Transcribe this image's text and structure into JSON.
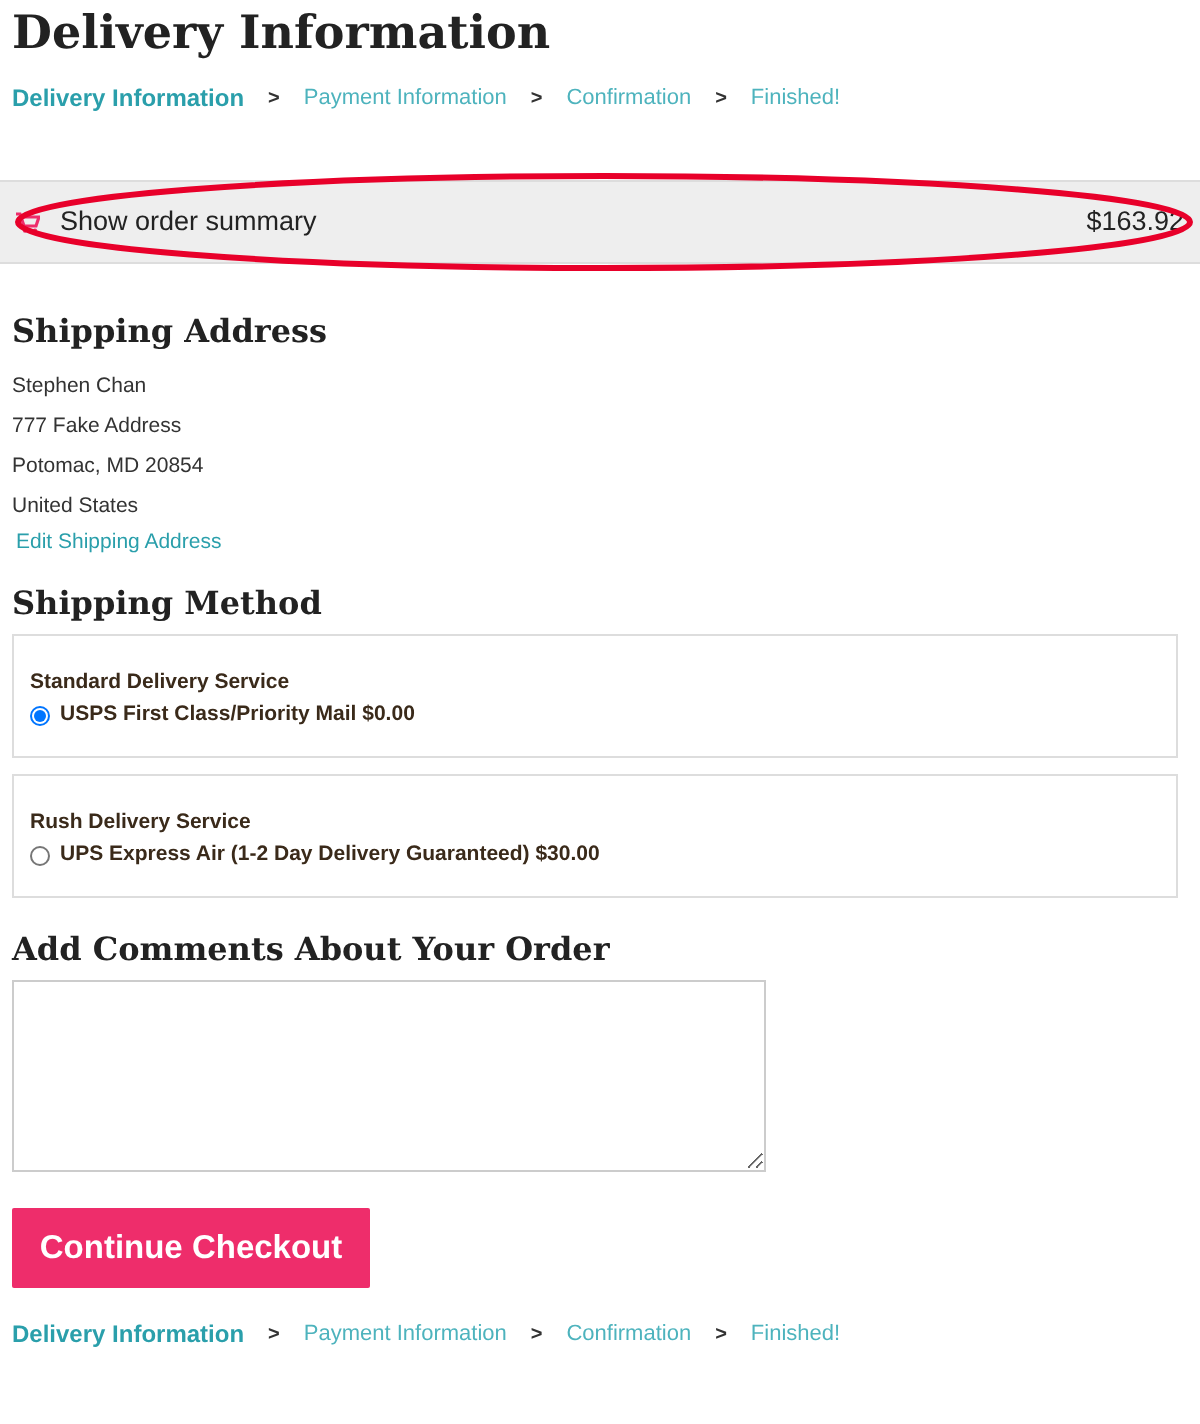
{
  "title": "Delivery Information",
  "breadcrumbs_top": {
    "separator": ">",
    "steps": [
      {
        "label": "Delivery Information",
        "selected": true
      },
      {
        "label": "Payment Information",
        "selected": false
      },
      {
        "label": "Confirmation",
        "selected": false
      },
      {
        "label": "Finished!",
        "selected": false
      }
    ]
  },
  "order_summary": {
    "label": "Show order summary",
    "total": "$163.92",
    "circled": true
  },
  "shipping_address": {
    "heading": "Shipping Address",
    "lines": [
      "Stephen Chan",
      "777 Fake Address",
      "Potomac, MD 20854",
      "United States"
    ],
    "edit_link": "Edit Shipping Address"
  },
  "shipping_method": {
    "heading": "Shipping Method",
    "options": [
      {
        "group": "Standard Delivery Service",
        "label": "USPS First Class/Priority Mail $0.00",
        "selected": true
      },
      {
        "group": "Rush Delivery Service",
        "label": "UPS Express Air (1-2 Day Delivery Guaranteed) $30.00",
        "selected": false
      }
    ]
  },
  "comments": {
    "heading": "Add Comments About Your Order"
  },
  "continue_button": "Continue Checkout",
  "breadcrumbs_bottom": {
    "separator": ">",
    "steps": [
      {
        "label": "Delivery Information",
        "selected": true
      },
      {
        "label": "Payment Information",
        "selected": false
      },
      {
        "label": "Confirmation",
        "selected": false
      },
      {
        "label": "Finished!",
        "selected": false
      }
    ]
  }
}
